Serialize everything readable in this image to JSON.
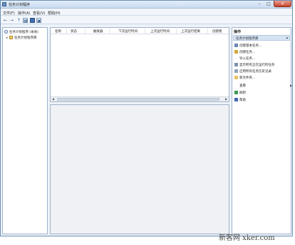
{
  "window": {
    "title": "任务计划程序",
    "controls": {
      "minimize": "–",
      "maximize": "□",
      "close": "✕"
    }
  },
  "menu": [
    "文件(F)",
    "操作(A)",
    "查看(V)",
    "帮助(H)"
  ],
  "toolbar": {
    "icons": [
      "back-icon",
      "forward-icon",
      "up-folder-icon",
      "show-tree-icon",
      "help-icon",
      "show-pane-icon"
    ],
    "glyphs": [
      "←",
      "→",
      "↑",
      "▦",
      "?",
      "▣"
    ]
  },
  "tree": {
    "root_label": "任务计划程序 (本地)",
    "child_label": "任务计划程序库"
  },
  "columns": [
    "名称",
    "状态",
    "触发器",
    "下次运行时间",
    "上次运行时间",
    "上次运行结果",
    "创建者"
  ],
  "actions": {
    "heading": "操作",
    "group_label": "任务计划程序库",
    "items": [
      {
        "label": "创建基本任务...",
        "icon": "wizard-icon",
        "color": "#6a88b4"
      },
      {
        "label": "创建任务...",
        "icon": "new-task-icon",
        "color": "#d0a93a"
      },
      {
        "label": "导入任务...",
        "icon": "",
        "color": ""
      },
      {
        "label": "显示所有正在运行的任务",
        "icon": "running-tasks-icon",
        "color": "#7d93b0"
      },
      {
        "label": "启用所有任务历史记录",
        "icon": "history-icon",
        "color": "#8fa2bd"
      },
      {
        "label": "新文件夹...",
        "icon": "folder-icon",
        "color": "#e8c564"
      },
      {
        "label": "查看",
        "icon": "",
        "color": ""
      },
      {
        "label": "刷新",
        "icon": "refresh-icon",
        "color": "#3d9a52"
      },
      {
        "label": "帮助",
        "icon": "help-icon",
        "color": "#3f68b3"
      }
    ]
  },
  "watermark": "新客网 xker.com"
}
